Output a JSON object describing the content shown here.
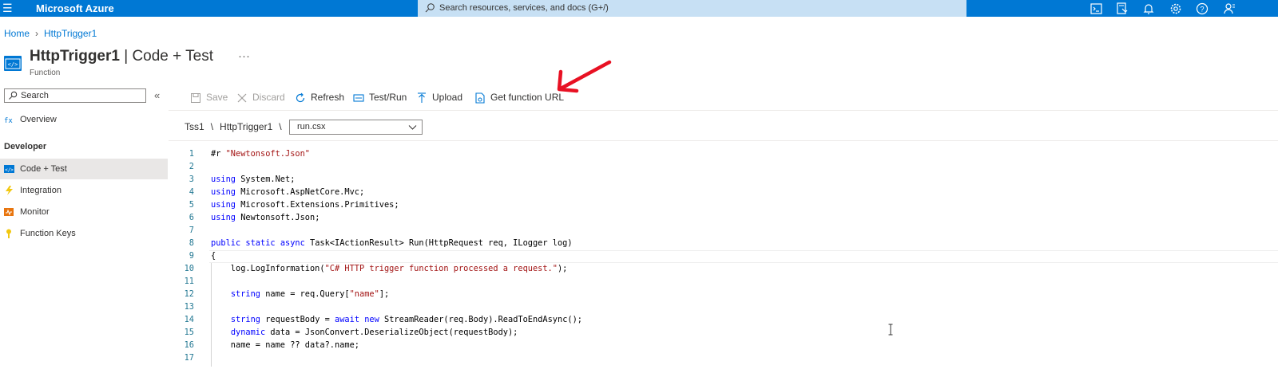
{
  "topbar": {
    "brand": "Microsoft Azure",
    "search_placeholder": "Search resources, services, and docs (G+/)",
    "icons": [
      "cloud-shell-icon",
      "directory-filter-icon",
      "notifications-icon",
      "settings-icon",
      "help-icon",
      "feedback-icon"
    ]
  },
  "breadcrumb": {
    "home": "Home",
    "current": "HttpTrigger1"
  },
  "header": {
    "title_main": "HttpTrigger1",
    "title_rest": " | Code + Test",
    "more": "···",
    "subtitle": "Function"
  },
  "nav": {
    "search_placeholder": "Search",
    "collapse": "«",
    "overview": "Overview",
    "section": "Developer",
    "items": [
      {
        "label": "Code + Test",
        "icon": "code-icon",
        "color": "#0078d4",
        "active": true
      },
      {
        "label": "Integration",
        "icon": "lightning-icon",
        "color": "#f2c811"
      },
      {
        "label": "Monitor",
        "icon": "monitor-icon",
        "color": "#e8750e"
      },
      {
        "label": "Function Keys",
        "icon": "key-icon",
        "color": "#f2c811"
      }
    ]
  },
  "toolbar": {
    "save": "Save",
    "discard": "Discard",
    "refresh": "Refresh",
    "testrun": "Test/Run",
    "upload": "Upload",
    "get_url": "Get function URL"
  },
  "path": {
    "app": "Tss1",
    "sep1": "\\",
    "function": "HttpTrigger1",
    "sep2": "\\",
    "file": "run.csx"
  },
  "editor": {
    "line_numbers": [
      "1",
      "2",
      "3",
      "4",
      "5",
      "6",
      "7",
      "8",
      "9",
      "10",
      "11",
      "12",
      "13",
      "14",
      "15",
      "16",
      "17"
    ],
    "lines": [
      "#r \"Newtonsoft.Json\"",
      "",
      "using System.Net;",
      "using Microsoft.AspNetCore.Mvc;",
      "using Microsoft.Extensions.Primitives;",
      "using Newtonsoft.Json;",
      "",
      "public static async Task<IActionResult> Run(HttpRequest req, ILogger log)",
      "{",
      "    log.LogInformation(\"C# HTTP trigger function processed a request.\");",
      "",
      "    string name = req.Query[\"name\"];",
      "",
      "    string requestBody = await new StreamReader(req.Body).ReadToEndAsync();",
      "    dynamic data = JsonConvert.DeserializeObject(requestBody);",
      "    name = name ?? data?.name;",
      ""
    ]
  },
  "colors": {
    "accent": "#0078d4",
    "annotation": "#e81123"
  }
}
